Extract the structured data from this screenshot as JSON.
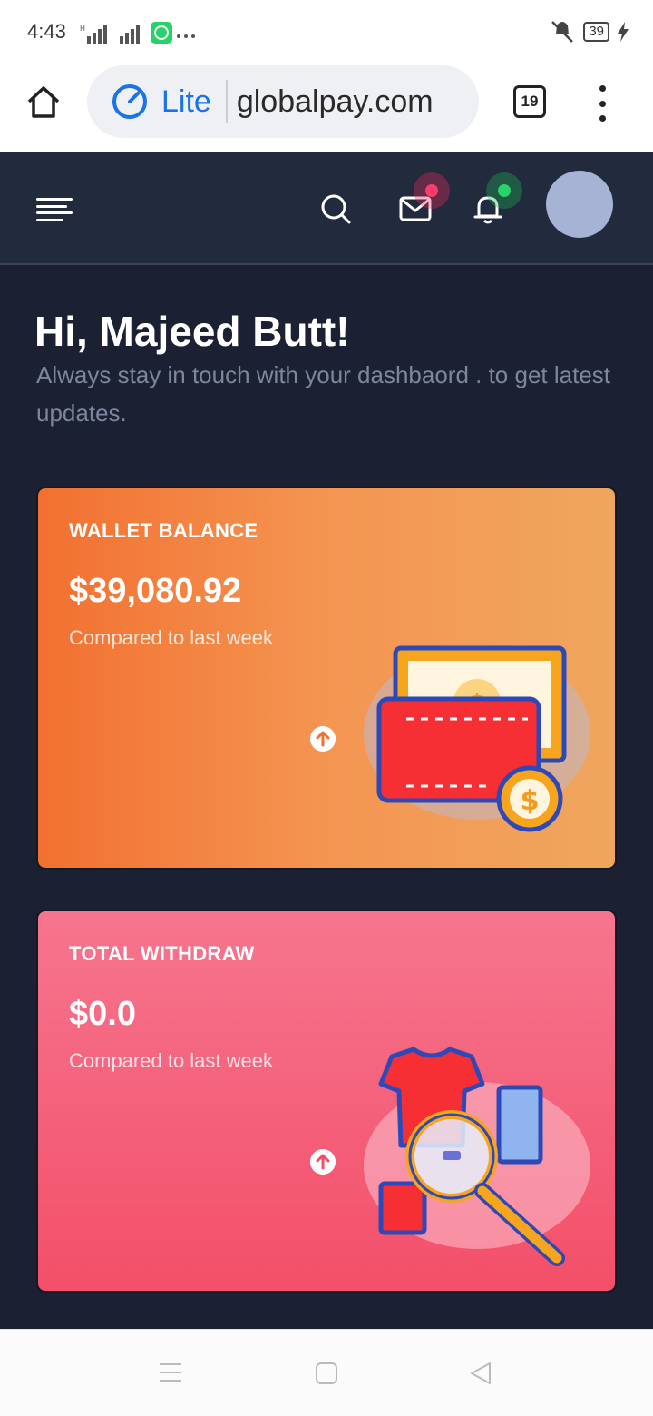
{
  "status_bar": {
    "time": "4:43",
    "battery": "39"
  },
  "browser": {
    "mode_label": "Lite",
    "url": "globalpay.com",
    "tab_count": "19"
  },
  "app": {
    "greeting": "Hi, Majeed Butt!",
    "subtitle": "Always stay in touch with your dashbaord . to get latest updates.",
    "cards": [
      {
        "label": "WALLET BALANCE",
        "amount": "$39,080.92",
        "compare": "Compared to last week",
        "trend_icon": "arrow-up-circle-icon",
        "illustration": "wallet-cash-illustration"
      },
      {
        "label": "TOTAL WITHDRAW",
        "amount": "$0.0",
        "compare": "Compared to last week",
        "trend_icon": "arrow-up-circle-icon",
        "illustration": "clothes-magnifier-illustration"
      }
    ]
  },
  "colors": {
    "app_bg": "#1b2032",
    "navbar_bg": "#222a3e",
    "wallet_card": "#f27030",
    "withdraw_card": "#f34f69",
    "accent_blue": "#1a73e8"
  }
}
